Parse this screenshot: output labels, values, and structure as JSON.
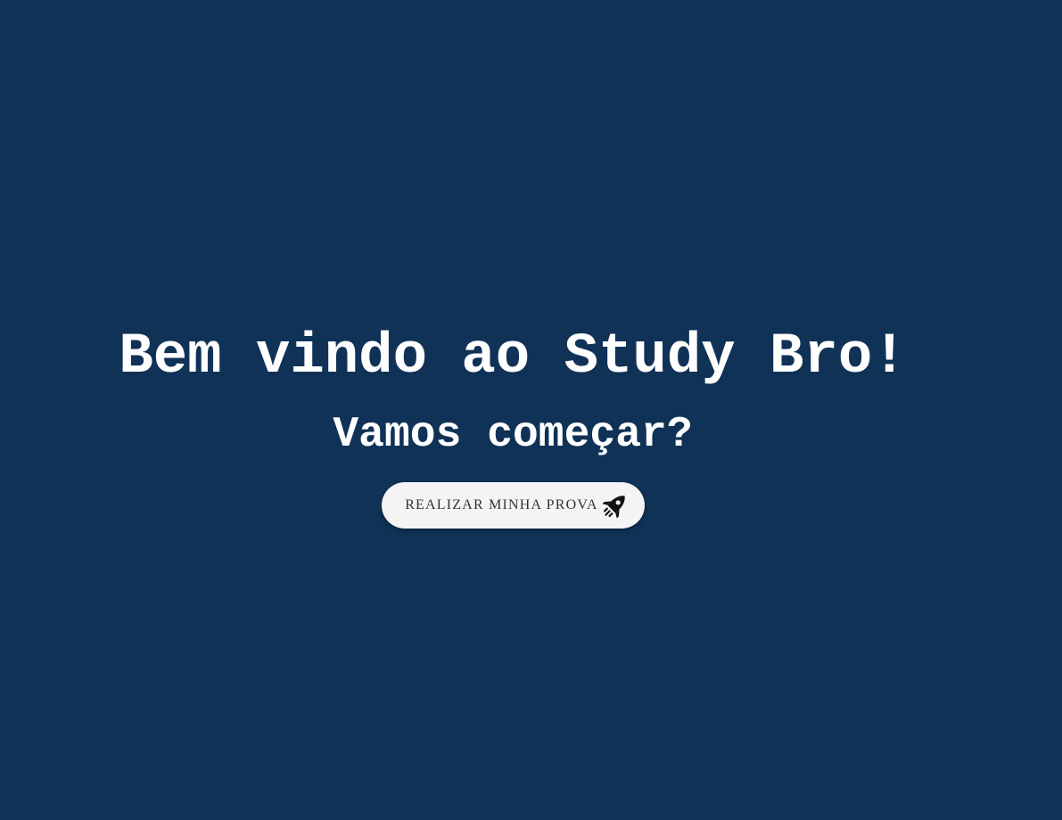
{
  "hero": {
    "title": "Bem vindo ao Study Bro!",
    "subtitle": "Vamos começar?"
  },
  "cta": {
    "label": "REALIZAR MINHA PROVA",
    "icon": "rocket-icon"
  },
  "colors": {
    "background": "#103257",
    "text": "#ffffff",
    "button_background": "#f5f4f4",
    "button_text": "#333333"
  }
}
